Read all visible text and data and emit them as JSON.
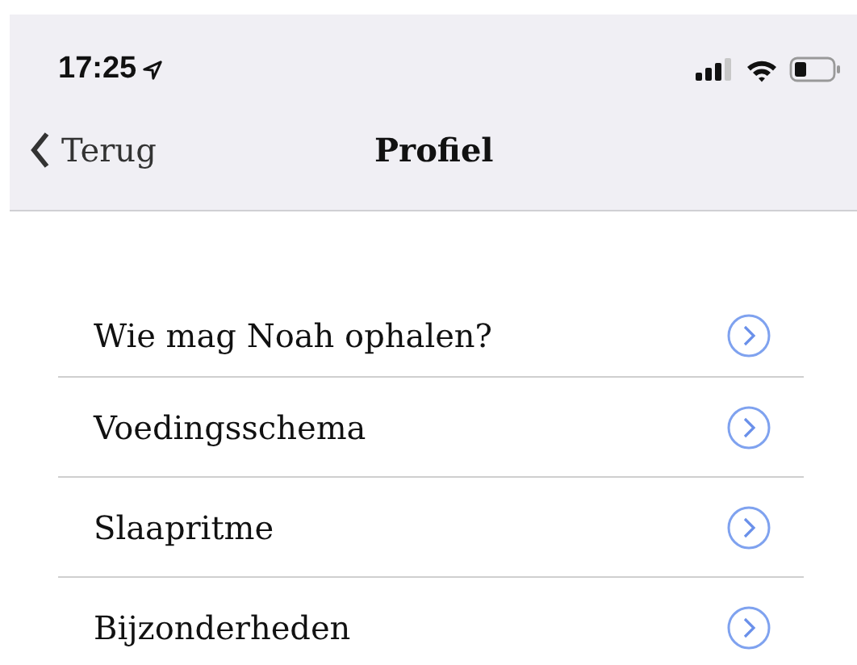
{
  "status_bar": {
    "time": "17:25"
  },
  "nav": {
    "back": "Terug",
    "title": "Profiel"
  },
  "items": [
    {
      "label": "Wie mag Noah ophalen?"
    },
    {
      "label": "Voedingsschema"
    },
    {
      "label": "Slaapritme"
    },
    {
      "label": "Bijzonderheden"
    }
  ]
}
